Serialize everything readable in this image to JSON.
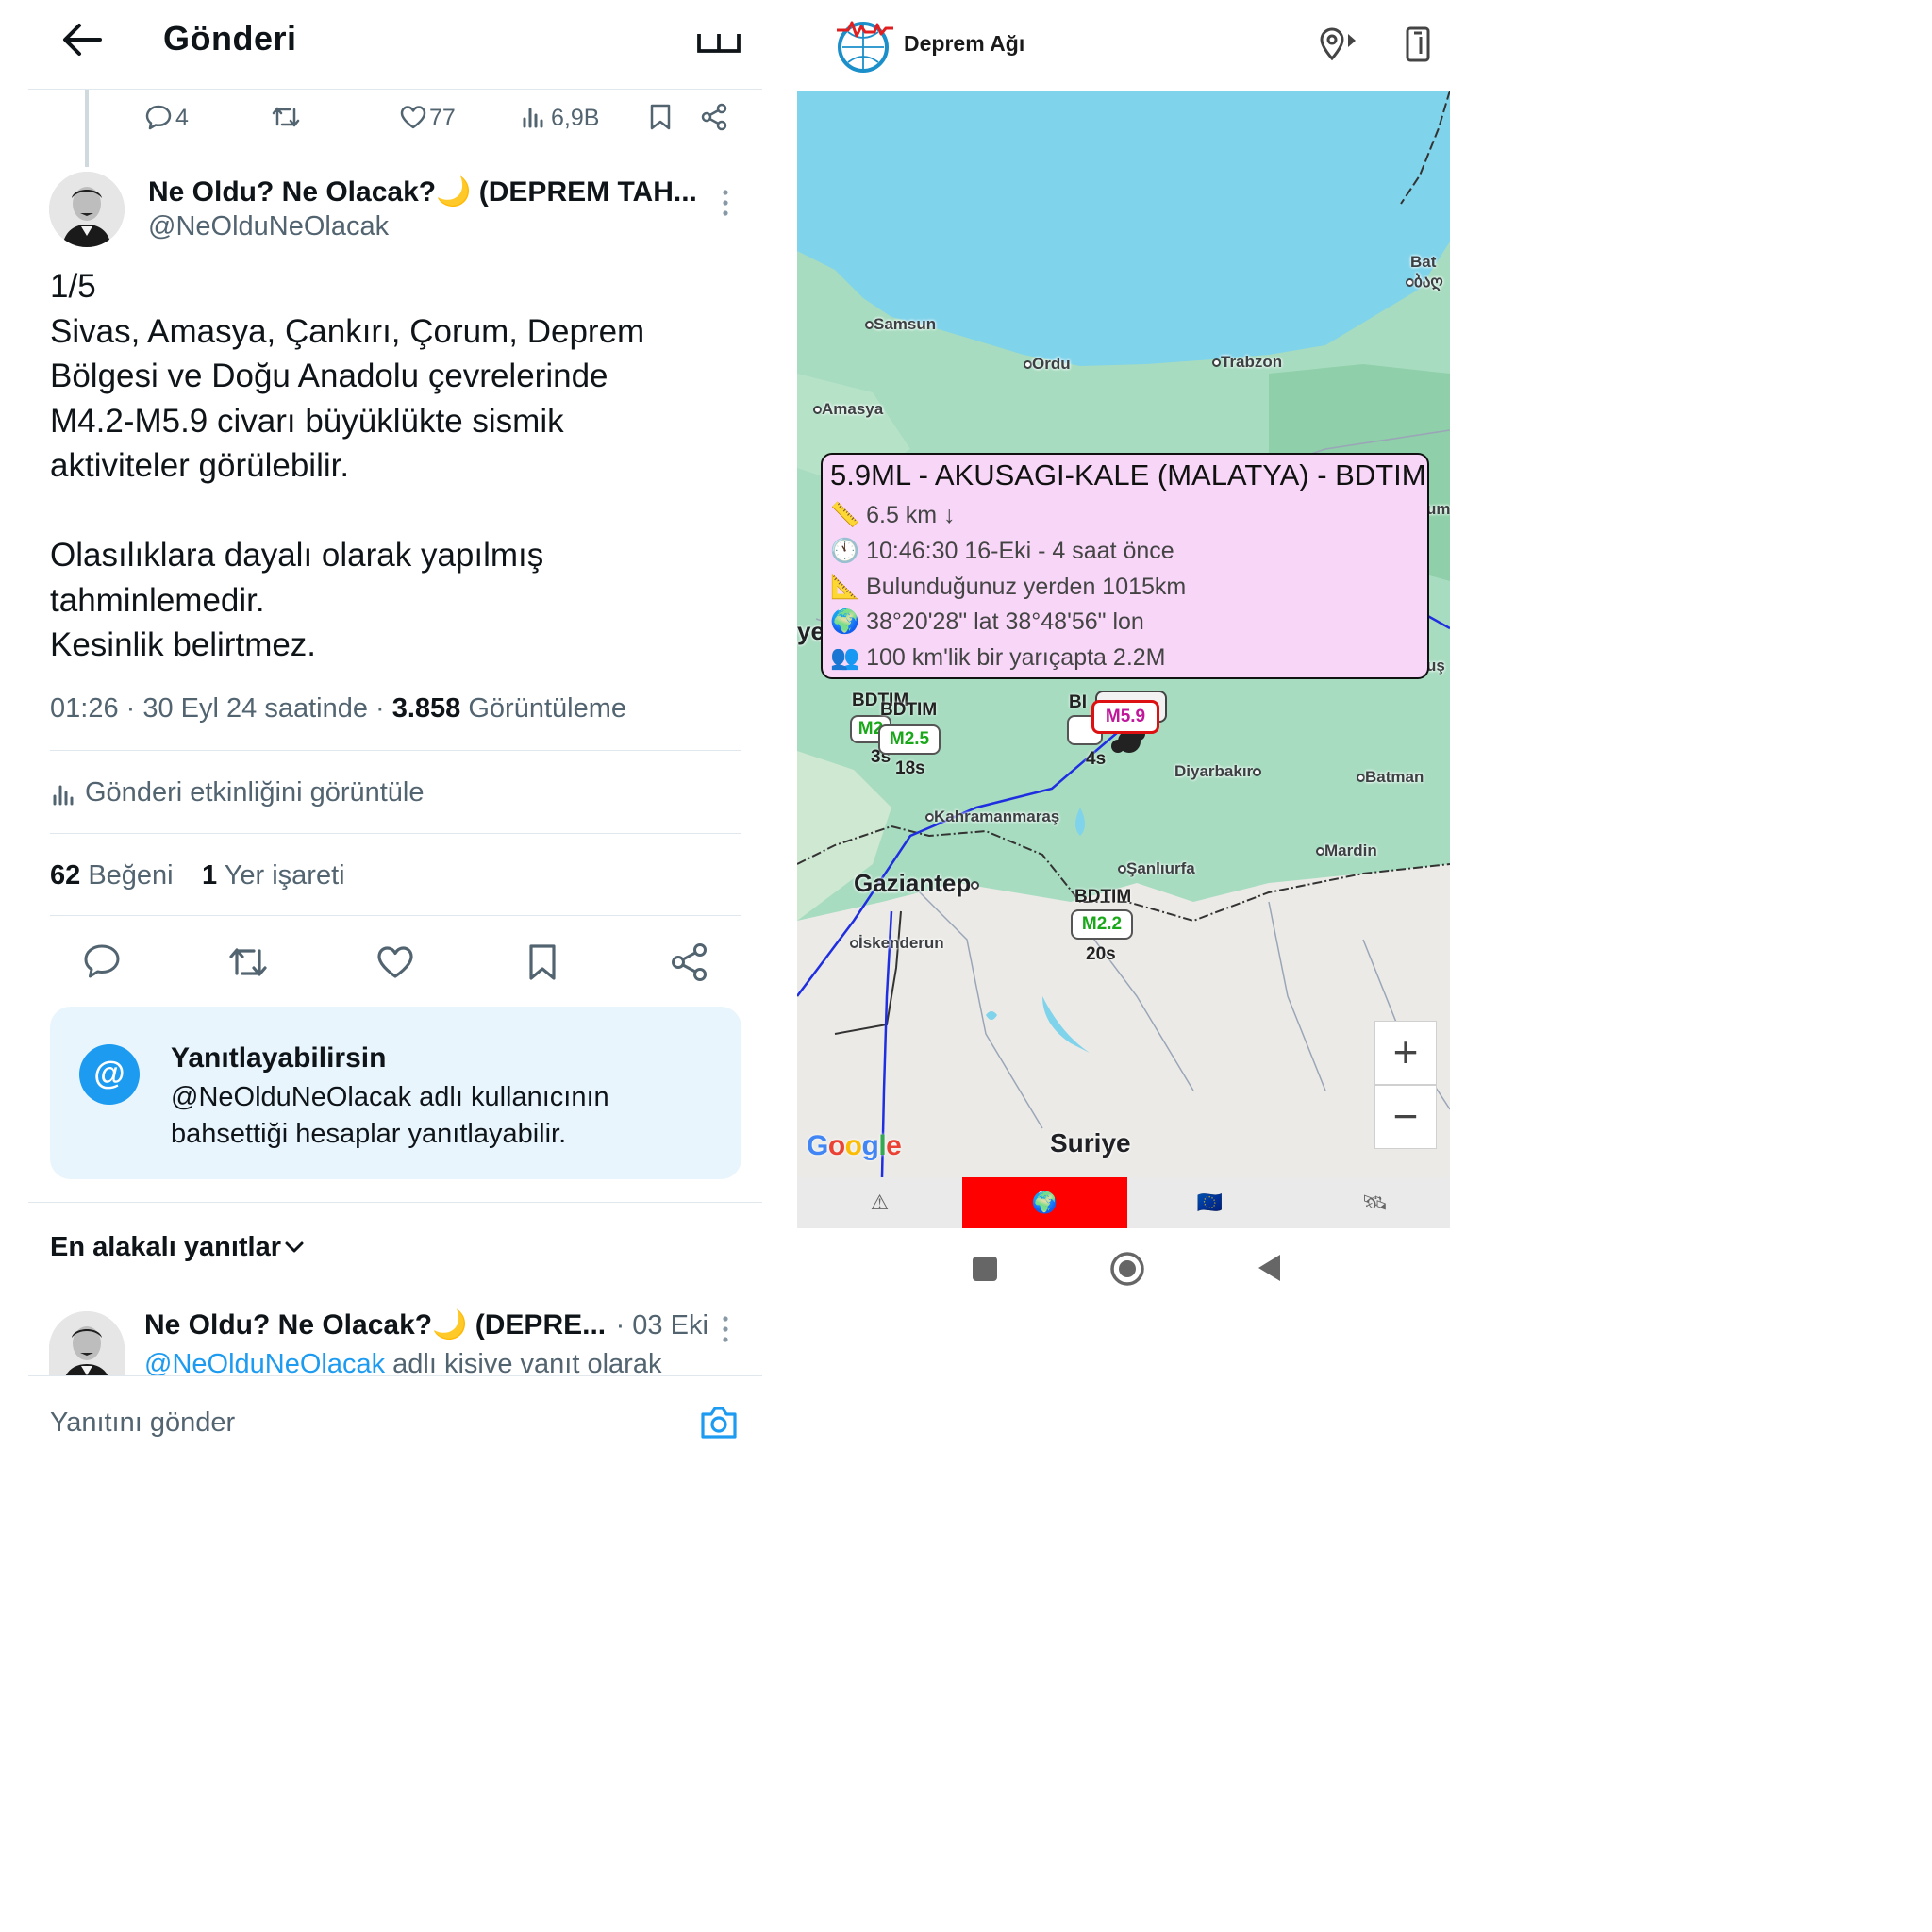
{
  "left": {
    "header": {
      "title": "Gönderi"
    },
    "parent_actions": {
      "replies": "4",
      "likes": "77",
      "views": "6,9B"
    },
    "post": {
      "author_name": "Ne Oldu? Ne Olacak?🌙 (DEPREM TAH...",
      "handle": "@NeOlduNeOlacak",
      "text": "1/5\nSivas, Amasya, Çankırı, Çorum, Deprem\nBölgesi ve Doğu Anadolu çevrelerinde\nM4.2-M5.9 civarı büyüklükte sismik\naktiviteler görülebilir.\n\nOlasılıklara dayalı olarak yapılmış\ntahminlemedir.\nKesinlik belirtmez.",
      "meta_time": "01:26 · 30 Eyl 24 saatinde · ",
      "views_count": "3.858",
      "views_label": " Görüntüleme",
      "activity_label": "Gönderi etkinliğini görüntüle",
      "likes_count": "62",
      "likes_label": "Beğeni",
      "bookmarks_count": "1",
      "bookmarks_label": "Yer işareti"
    },
    "reply_restriction": {
      "title": "Yanıtlayabilirsin",
      "line1": "@NeOlduNeOlacak adlı kullanıcının",
      "line2": "bahsettiği hesaplar yanıtlayabilir."
    },
    "replies_sort": {
      "label": "En alakalı yanıtlar"
    },
    "reply_preview": {
      "author_name": "Ne Oldu? Ne Olacak?🌙 (DEPRE...",
      "date": "· 03 Eki",
      "mention": "@NeOlduNeOlacak",
      "text_suffix": " adlı kisive vanıt olarak"
    },
    "composer": {
      "placeholder": "Yanıtını gönder"
    }
  },
  "right": {
    "app": {
      "title": "Deprem Ağı"
    },
    "map": {
      "cities": [
        "Samsun",
        "Ordu",
        "Trabzon",
        "Amasya",
        "Diyarbakır",
        "Batman",
        "Kahramanmaraş",
        "Mardin",
        "Şanlıurfa",
        "Gaziantep",
        "İskenderun",
        "Suriye",
        "Bat",
        "ბაღ",
        "um",
        "ye",
        "uş"
      ],
      "attribution": "Google",
      "popup": {
        "title": "5.9ML - AKUSAGI-KALE (MALATYA) - BDTIM",
        "depth": "6.5 km ↓",
        "time": "10:46:30 16-Eki - 4 saat önce",
        "distance": "Bulunduğunuz yerden 1015km",
        "coords": "38°20'28\" lat 38°48'56\" lon",
        "population": "100 km'lik bir yarıçapta 2.2M"
      },
      "markers": [
        {
          "source": "BDTIM",
          "magnitude": "M2.5",
          "age": "18s",
          "color": "#1aa81a"
        },
        {
          "source": "BDTIM",
          "magnitude": "M2",
          "age": "3s",
          "color": "#1aa81a"
        },
        {
          "source": "BI",
          "magnitude": "M5.9",
          "age": "4s",
          "color": "#c0179b"
        },
        {
          "source": "BDTIM",
          "magnitude": "M2.2",
          "age": "20s",
          "color": "#1aa81a"
        }
      ],
      "zoom_in": "+",
      "zoom_out": "−"
    },
    "tabs": [
      "⚠",
      "🌍",
      "🇪🇺",
      "🛰"
    ],
    "active_tab_color": "#ff0000"
  }
}
